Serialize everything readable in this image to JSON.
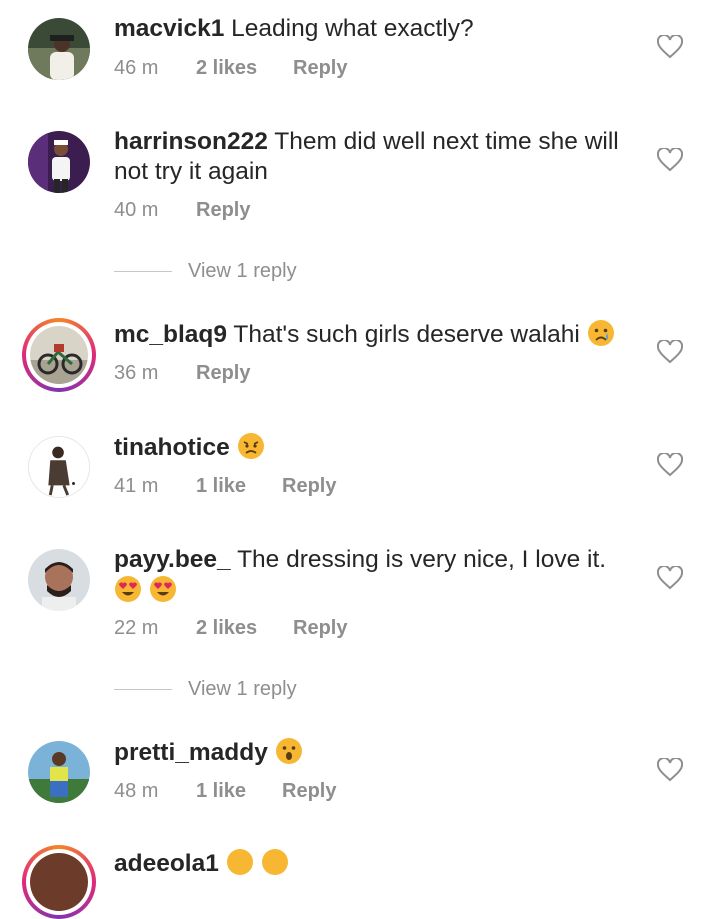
{
  "comments": [
    {
      "username": "macvick1",
      "text": "Leading what exactly?",
      "time": "46 m",
      "likes": "2 likes",
      "reply": "Reply"
    },
    {
      "username": "harrinson222",
      "text": "Them did well next time she will not try it again",
      "time": "40 m",
      "likes": "",
      "reply": "Reply",
      "view_replies": "View 1 reply"
    },
    {
      "username": "mc_blaq9",
      "text": "That's such girls deserve walahi",
      "time": "36 m",
      "likes": "",
      "reply": "Reply",
      "emoji": "crying-face"
    },
    {
      "username": "tinahotice",
      "text": "",
      "time": "41 m",
      "likes": "1 like",
      "reply": "Reply",
      "emoji": "persevering-face"
    },
    {
      "username": "payy.bee_",
      "text": "The dressing is very nice, I love it.",
      "time": "22 m",
      "likes": "2 likes",
      "reply": "Reply",
      "emoji": "heart-eyes-face",
      "view_replies": "View 1 reply"
    },
    {
      "username": "pretti_maddy",
      "text": "",
      "time": "48 m",
      "likes": "1 like",
      "reply": "Reply",
      "emoji": "astonished-face"
    },
    {
      "username": "adeeola1",
      "text": "",
      "time": "",
      "likes": "",
      "reply": "",
      "emoji": "grinning-face"
    }
  ],
  "icons": {
    "like": "heart-outline-icon"
  },
  "colors": {
    "username": "#262626",
    "meta": "#8e8e8e",
    "story_ring": "#dd2a7b"
  }
}
